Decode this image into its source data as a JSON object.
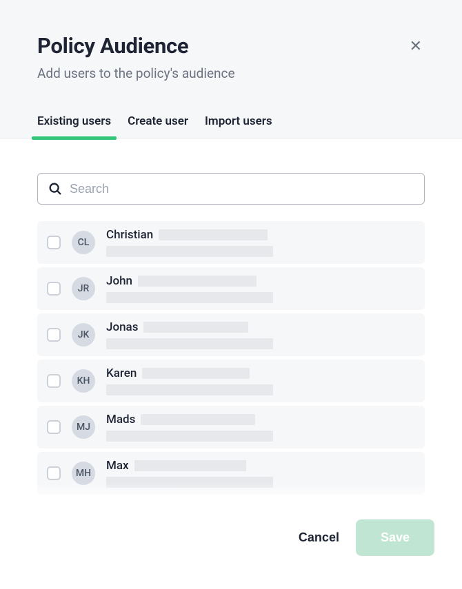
{
  "header": {
    "title": "Policy Audience",
    "subtitle": "Add users to the policy's audience"
  },
  "tabs": [
    {
      "label": "Existing users",
      "active": true
    },
    {
      "label": "Create user",
      "active": false
    },
    {
      "label": "Import users",
      "active": false
    }
  ],
  "search": {
    "placeholder": "Search",
    "value": ""
  },
  "users": [
    {
      "initials": "CL",
      "name": "Christian",
      "redactTopW": 158,
      "redactBotW": 242
    },
    {
      "initials": "JR",
      "name": "John",
      "redactTopW": 172,
      "redactBotW": 242
    },
    {
      "initials": "JK",
      "name": "Jonas",
      "redactTopW": 152,
      "redactBotW": 242
    },
    {
      "initials": "KH",
      "name": "Karen",
      "redactTopW": 156,
      "redactBotW": 242
    },
    {
      "initials": "MJ",
      "name": "Mads",
      "redactTopW": 166,
      "redactBotW": 242
    },
    {
      "initials": "MH",
      "name": "Max",
      "redactTopW": 162,
      "redactBotW": 242
    }
  ],
  "footer": {
    "cancel_label": "Cancel",
    "save_label": "Save"
  }
}
